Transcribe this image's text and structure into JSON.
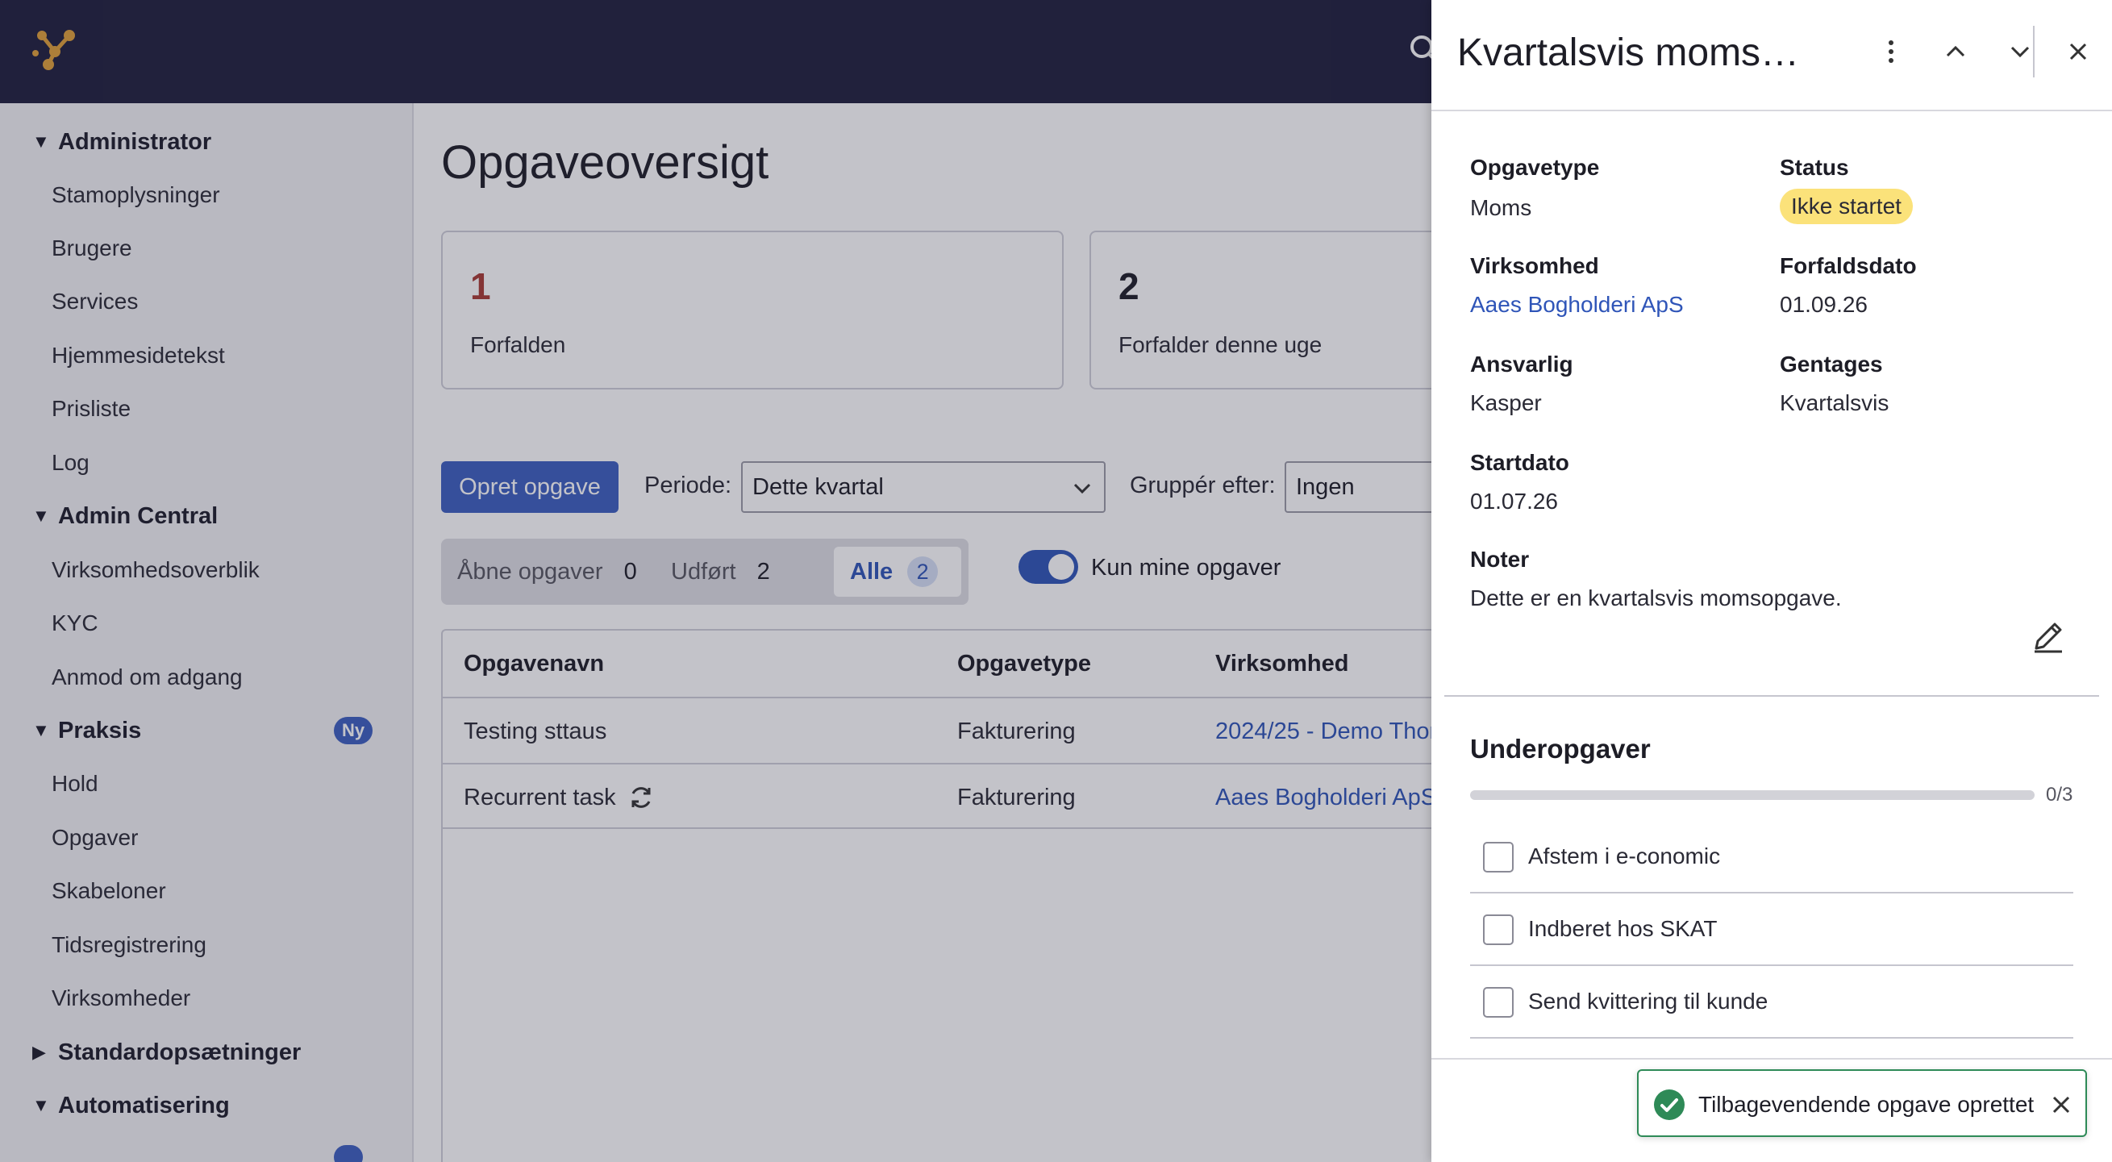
{
  "colors": {
    "topbar": "#1e1e3c",
    "accent": "#3c5fbf",
    "link": "#2f55b8",
    "overdue": "#a83a32",
    "status_pill": "#fbe27a",
    "success": "#2e8a57"
  },
  "sidebar": {
    "groups": [
      {
        "label": "Administrator",
        "expanded": true,
        "items": [
          "Stamoplysninger",
          "Brugere",
          "Services",
          "Hjemmesidetekst",
          "Prisliste",
          "Log"
        ]
      },
      {
        "label": "Admin Central",
        "expanded": true,
        "items": [
          "Virksomhedsoverblik",
          "KYC",
          "Anmod om adgang"
        ]
      },
      {
        "label": "Praksis",
        "expanded": true,
        "badge": "Ny",
        "items": [
          "Hold",
          "Opgaver",
          "Skabeloner",
          "Tidsregistrering",
          "Virksomheder"
        ]
      },
      {
        "label": "Standardopsætninger",
        "expanded": false,
        "items": []
      },
      {
        "label": "Automatisering",
        "expanded": true,
        "items": []
      }
    ]
  },
  "main": {
    "title": "Opgaveoversigt",
    "cards": [
      {
        "value": "1",
        "label": "Forfalden"
      },
      {
        "value": "2",
        "label": "Forfalder denne uge"
      }
    ],
    "create_button": "Opret opgave",
    "period_label": "Periode:",
    "period_value": "Dette kvartal",
    "group_label": "Gruppér efter:",
    "group_value": "Ingen",
    "segments": [
      {
        "label": "Åbne opgaver",
        "count": "0"
      },
      {
        "label": "Udført",
        "count": "2"
      },
      {
        "label": "Alle",
        "count": "2",
        "active": true
      }
    ],
    "toggle_label": "Kun mine opgaver",
    "toggle_on": true,
    "table": {
      "headers": [
        "Opgavenavn",
        "Opgavetype",
        "Virksomhed"
      ],
      "rows": [
        {
          "name": "Testing sttaus",
          "type": "Fakturering",
          "company": "2024/25 - Demo Thor",
          "recurring": false
        },
        {
          "name": "Recurrent task",
          "type": "Fakturering",
          "company": "Aaes Bogholderi ApS",
          "recurring": true
        }
      ]
    }
  },
  "drawer": {
    "title": "Kvartalsvis moms…",
    "fields": {
      "type_label": "Opgavetype",
      "type_value": "Moms",
      "status_label": "Status",
      "status_value": "Ikke startet",
      "company_label": "Virksomhed",
      "company_value": "Aaes Bogholderi ApS",
      "due_label": "Forfaldsdato",
      "due_value": "01.09.26",
      "owner_label": "Ansvarlig",
      "owner_value": "Kasper",
      "repeat_label": "Gentages",
      "repeat_value": "Kvartalsvis",
      "start_label": "Startdato",
      "start_value": "01.07.26",
      "notes_label": "Noter",
      "notes_value": "Dette er en kvartalsvis momsopgave."
    },
    "subtasks_title": "Underopgaver",
    "progress_text": "0/3",
    "progress_fraction": 0,
    "subtasks": [
      "Afstem i e-conomic",
      "Indberet hos SKAT",
      "Send kvittering til kunde"
    ]
  },
  "toast": {
    "message": "Tilbagevendende opgave oprettet"
  }
}
